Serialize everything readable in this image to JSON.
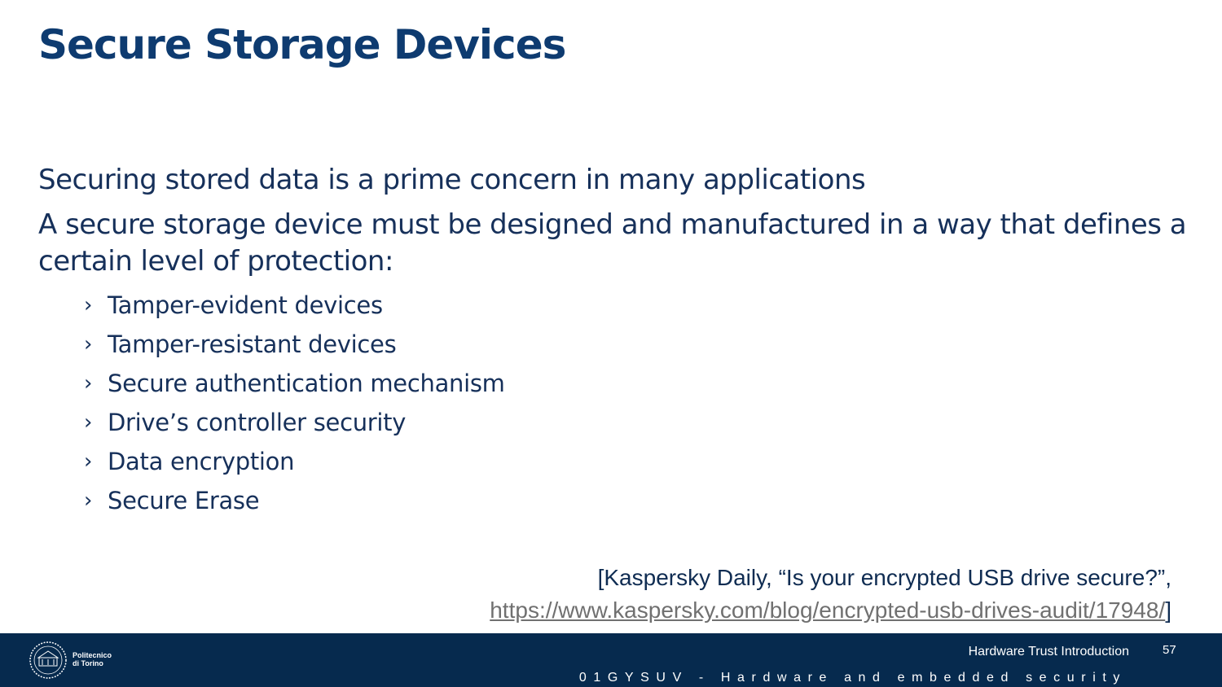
{
  "slide": {
    "title": "Secure Storage Devices",
    "paragraphs": [
      "Securing stored data is a prime concern in many applications",
      "A secure storage device must be designed and manufactured in a way that defines a certain level of protection:"
    ],
    "bullet_marker": "›",
    "bullets": [
      "Tamper-evident devices",
      "Tamper-resistant devices",
      "Secure authentication mechanism",
      "Drive’s controller security",
      "Data encryption",
      "Secure Erase"
    ],
    "citation": {
      "line1": "[Kaspersky Daily, “Is your encrypted USB drive secure?”,",
      "link": "https://www.kaspersky.com/blog/encrypted-usb-drives-audit/17948/",
      "suffix": "]"
    }
  },
  "footer": {
    "logo_text_line1": "Politecnico",
    "logo_text_line2": "di Torino",
    "section_title": "Hardware Trust Introduction",
    "page_number": "57",
    "course": "01GYSUV - Hardware and embedded security",
    "background_color": "#062a4e"
  },
  "colors": {
    "title": "#0e3b70",
    "body_text": "#16305a",
    "link": "#707070"
  }
}
